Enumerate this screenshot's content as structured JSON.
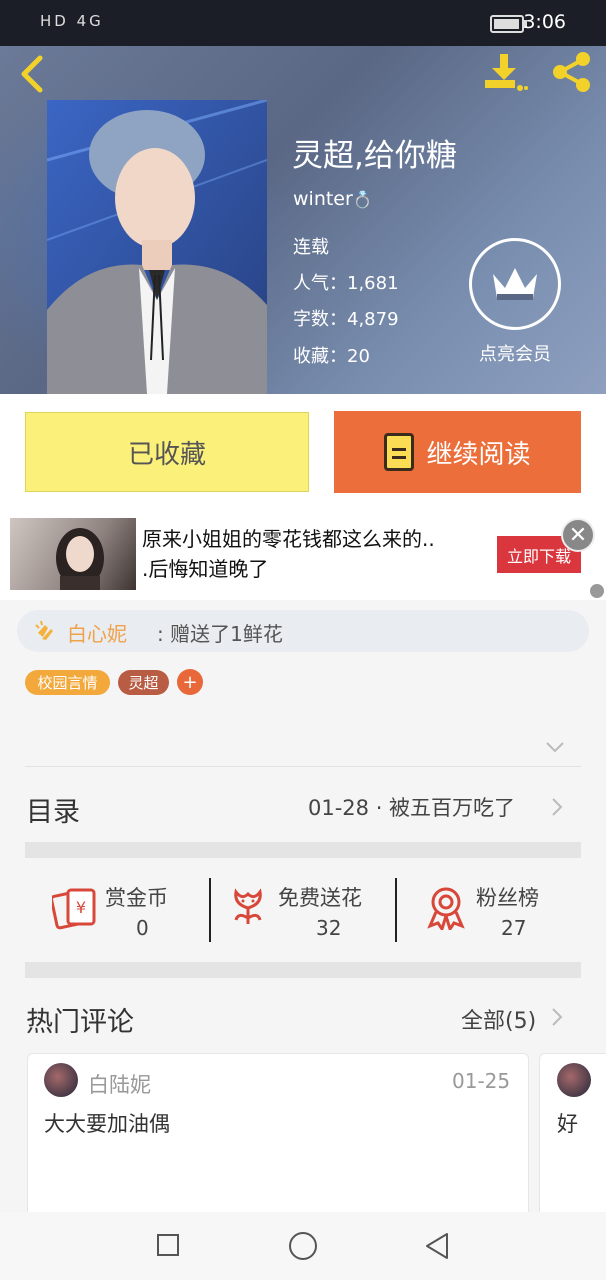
{
  "status_bar": {
    "left_icons": "HD 4G",
    "time": "3:06"
  },
  "header": {
    "title": "灵超,给你糖",
    "author": "winter",
    "status": "连载",
    "stats": [
      {
        "label": "人气：",
        "value": "1,681"
      },
      {
        "label": "字数：",
        "value": "4,879"
      },
      {
        "label": "收藏：",
        "value": "20"
      }
    ],
    "vip_label": "点亮会员"
  },
  "actions": {
    "collected_label": "已收藏",
    "read_label": "继续阅读"
  },
  "ad": {
    "text_line1": "原来小姐姐的零花钱都这么来的..",
    "text_line2": ".后悔知道晚了",
    "cta": "立即下载",
    "close": "✕"
  },
  "gift": {
    "user": "白心妮",
    "message": ": 赠送了1鲜花"
  },
  "tags": [
    {
      "label": "校园言情"
    },
    {
      "label": "灵超"
    }
  ],
  "tag_add": "+",
  "catalog": {
    "label": "目录",
    "latest": "01-28 · 被五百万吃了"
  },
  "stats_row": [
    {
      "label": "赏金币",
      "value": "0"
    },
    {
      "label": "免费送花",
      "value": "32"
    },
    {
      "label": "粉丝榜",
      "value": "27"
    }
  ],
  "comments": {
    "label": "热门评论",
    "all_label": "全部(5)",
    "items": [
      {
        "user": "白陆妮",
        "date": "01-25",
        "text": "大大要加油偶"
      },
      {
        "text": "好"
      }
    ]
  },
  "colors": {
    "accent_orange": "#ec6e3a",
    "collected_yellow": "#fbf07a",
    "ad_red": "#d9363e"
  },
  "icons": [
    "back-icon",
    "download-icon",
    "share-icon",
    "crown-icon",
    "book-icon",
    "close-icon",
    "clap-icon",
    "chevron-down-icon",
    "chevron-right-icon",
    "coin-envelope-icon",
    "flower-icon",
    "ribbon-medal-icon",
    "nav-square-icon",
    "nav-circle-icon",
    "nav-back-icon"
  ]
}
